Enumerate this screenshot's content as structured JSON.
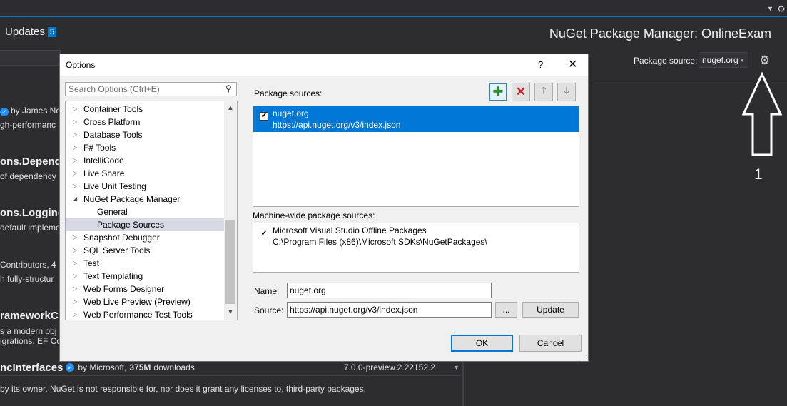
{
  "ide": {
    "updates_tab": "Updates",
    "updates_count": "5",
    "title": "NuGet Package Manager: OnlineExam",
    "package_source_label": "Package source:",
    "package_source_value": "nuget.org",
    "annotation_number": "1"
  },
  "packages": [
    {
      "name": "",
      "by": "by James Ne",
      "desc": "gh-performanc"
    },
    {
      "name": "ons.Depende",
      "desc": "of dependency"
    },
    {
      "name": "ons.Logging",
      "desc": "default impleme"
    },
    {
      "name": "",
      "by": "Contributors, 4",
      "desc": "h fully-structur"
    },
    {
      "name": "rameworkCo",
      "desc": "s a modern obj",
      "desc2": "igrations. EF Co"
    }
  ],
  "bottom_package": {
    "name": "ncInterfaces",
    "by": "by Microsoft,",
    "downloads": "375M",
    "downloads_suffix": "downloads",
    "version": "7.0.0-preview.2.22152.2"
  },
  "disclaimer": "by its owner. NuGet is not responsible for, nor does it grant any licenses to, third-party packages.",
  "dialog": {
    "title": "Options",
    "help": "?",
    "close": "✕",
    "search_placeholder": "Search Options (Ctrl+E)",
    "tree": [
      {
        "label": "Container Tools",
        "expanded": false
      },
      {
        "label": "Cross Platform",
        "expanded": false
      },
      {
        "label": "Database Tools",
        "expanded": false
      },
      {
        "label": "F# Tools",
        "expanded": false
      },
      {
        "label": "IntelliCode",
        "expanded": false
      },
      {
        "label": "Live Share",
        "expanded": false
      },
      {
        "label": "Live Unit Testing",
        "expanded": false
      },
      {
        "label": "NuGet Package Manager",
        "expanded": true
      },
      {
        "label": "General",
        "child": true
      },
      {
        "label": "Package Sources",
        "child": true,
        "selected": true
      },
      {
        "label": "Snapshot Debugger",
        "expanded": false
      },
      {
        "label": "SQL Server Tools",
        "expanded": false
      },
      {
        "label": "Test",
        "expanded": false
      },
      {
        "label": "Text Templating",
        "expanded": false
      },
      {
        "label": "Web Forms Designer",
        "expanded": false
      },
      {
        "label": "Web Live Preview (Preview)",
        "expanded": false
      },
      {
        "label": "Web Performance Test Tools",
        "expanded": false
      }
    ],
    "package_sources_label": "Package sources:",
    "sources": [
      {
        "name": "nuget.org",
        "url": "https://api.nuget.org/v3/index.json",
        "checked": true
      }
    ],
    "machine_wide_label": "Machine-wide package sources:",
    "machine_sources": [
      {
        "name": "Microsoft Visual Studio Offline Packages",
        "path": "C:\\Program Files (x86)\\Microsoft SDKs\\NuGetPackages\\",
        "checked": true
      }
    ],
    "name_label": "Name:",
    "name_value": "nuget.org",
    "source_label": "Source:",
    "source_value": "https://api.nuget.org/v3/index.json",
    "browse_label": "...",
    "update_label": "Update",
    "ok_label": "OK",
    "cancel_label": "Cancel"
  }
}
